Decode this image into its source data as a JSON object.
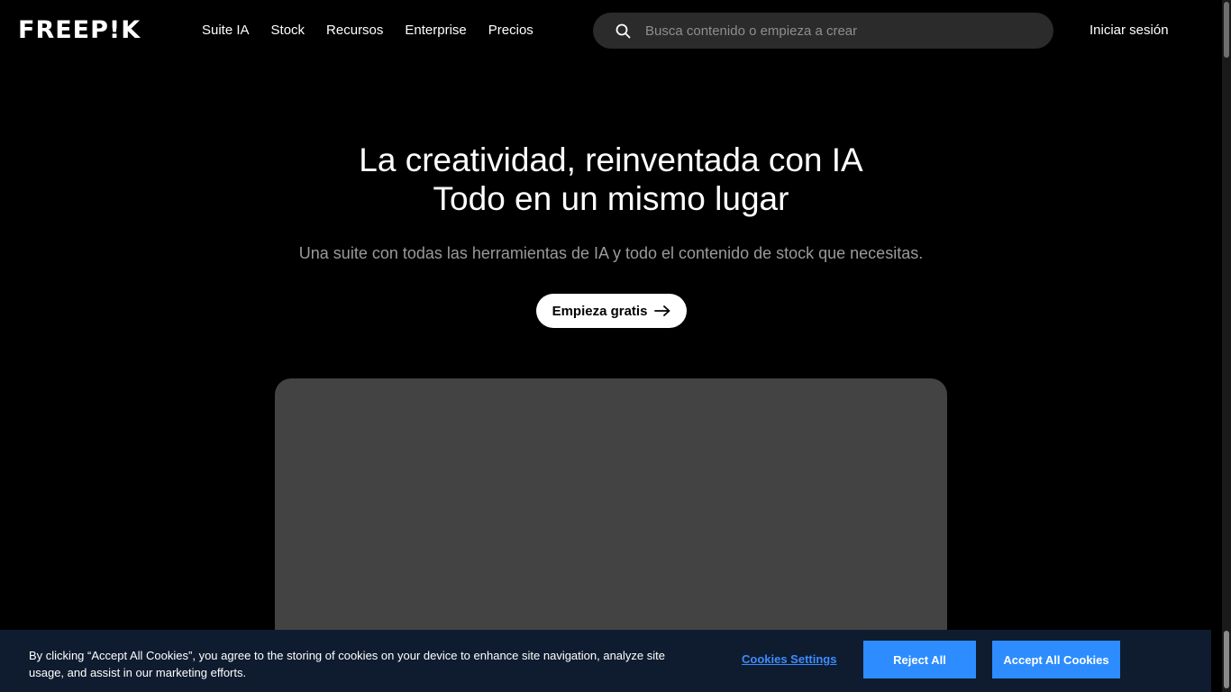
{
  "header": {
    "logo_text": "FREEP!K",
    "nav": [
      {
        "label": "Suite IA"
      },
      {
        "label": "Stock"
      },
      {
        "label": "Recursos"
      },
      {
        "label": "Enterprise"
      },
      {
        "label": "Precios"
      }
    ],
    "search": {
      "icon": "search-icon",
      "placeholder": "Busca contenido o empieza a crear",
      "value": ""
    },
    "login_label": "Iniciar sesión"
  },
  "hero": {
    "title_line1": "La creatividad, reinventada con IA",
    "title_line2": "Todo en un mismo lugar",
    "subtitle": "Una suite con todas las herramientas de IA y todo el contenido de stock que necesitas.",
    "cta_label": "Empieza gratis",
    "cta_icon": "arrow-right-icon"
  },
  "cookie_banner": {
    "text": "By clicking “Accept All Cookies”, you agree to the storing of cookies on your device to enhance site navigation, analyze site usage, and assist in our marketing efforts.",
    "settings_label": "Cookies Settings",
    "reject_label": "Reject All",
    "accept_label": "Accept All Cookies"
  },
  "colors": {
    "background": "#000000",
    "search_bg": "#2b2b2b",
    "media_placeholder": "#434343",
    "cookie_bg": "#0f1c2f",
    "cookie_button": "#2d8cff",
    "cookie_link": "#3d8bfd"
  }
}
